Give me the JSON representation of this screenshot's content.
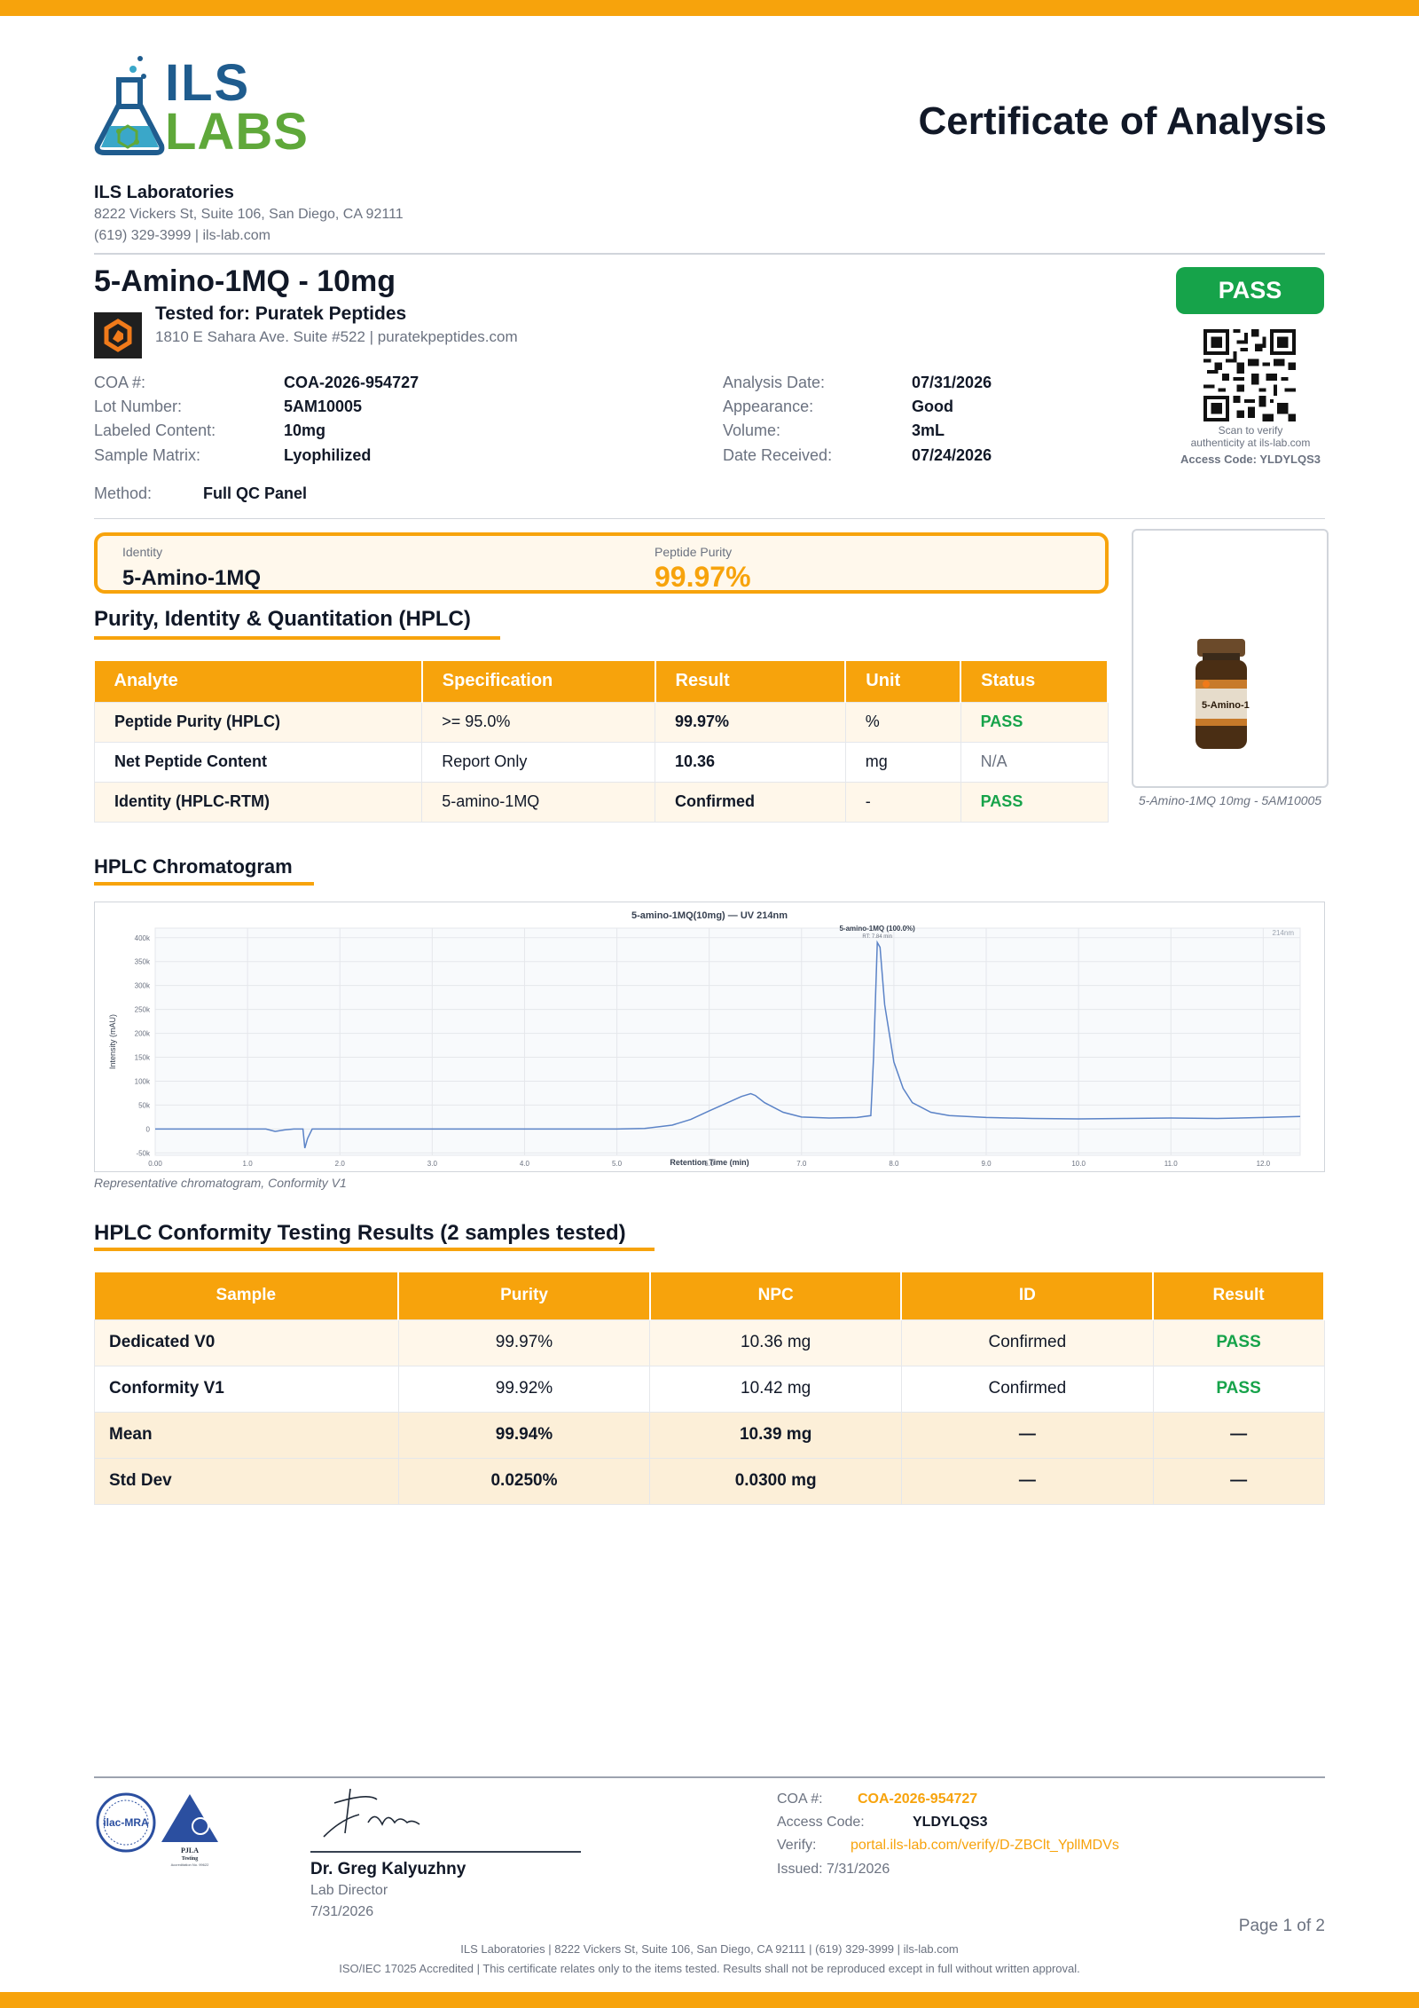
{
  "header": {
    "logo_top": "ILS",
    "logo_bottom": "LABS",
    "title": "Certificate of Analysis",
    "lab_name": "ILS Laboratories",
    "lab_address": "8222 Vickers St, Suite 106, San Diego, CA 92111",
    "lab_contact": "(619) 329-3999  |  ils-lab.com"
  },
  "product": {
    "title": "5-Amino-1MQ - 10mg",
    "tested_for": "Tested for: Puratek Peptides",
    "client_address": "1810 E Sahara Ave. Suite #522  |  puratekpeptides.com",
    "status": "PASS"
  },
  "qr": {
    "caption_1": "Scan to verify",
    "caption_2": "authenticity at ils-lab.com",
    "access_code": "Access Code: YLDYLQS3"
  },
  "meta_left": [
    {
      "label": "COA #:",
      "value": "COA-2026-954727"
    },
    {
      "label": "Lot Number:",
      "value": "5AM10005"
    },
    {
      "label": "Labeled Content:",
      "value": "10mg"
    },
    {
      "label": "Sample Matrix:",
      "value": "Lyophilized"
    }
  ],
  "meta_right": [
    {
      "label": "Analysis Date:",
      "value": "07/31/2026"
    },
    {
      "label": "Appearance:",
      "value": "Good"
    },
    {
      "label": "Volume:",
      "value": "3mL"
    },
    {
      "label": "Date Received:",
      "value": "07/24/2026"
    }
  ],
  "method": {
    "label": "Method:",
    "value": "Full QC Panel"
  },
  "summary": {
    "identity_label": "Identity",
    "identity_value": "5-Amino-1MQ",
    "purity_label": "Peptide Purity",
    "purity_value": "99.97%"
  },
  "vial": {
    "label_text": "5-Amino-1",
    "caption": "5-Amino-1MQ 10mg - 5AM10005"
  },
  "hplc_table": {
    "title": "Purity, Identity & Quantitation (HPLC)",
    "headers": [
      "Analyte",
      "Specification",
      "Result",
      "Unit",
      "Status"
    ],
    "rows": [
      [
        "Peptide Purity (HPLC)",
        ">= 95.0%",
        "99.97%",
        "%",
        "PASS"
      ],
      [
        "Net Peptide Content",
        "Report Only",
        "10.36",
        "mg",
        "N/A"
      ],
      [
        "Identity (HPLC-RTM)",
        "5-amino-1MQ",
        "Confirmed",
        "-",
        "PASS"
      ]
    ]
  },
  "chromatogram": {
    "section_title": "HPLC Chromatogram",
    "caption": "Representative chromatogram, Conformity V1"
  },
  "chart_data": {
    "type": "line",
    "title": "5-amino-1MQ(10mg) — UV 214nm",
    "xlabel": "Retention Time (min)",
    "ylabel": "Intensity (mAU)",
    "xlim": [
      0,
      12.4
    ],
    "ylim": [
      -55000,
      420000
    ],
    "x_ticks": [
      "0.00",
      "1.0",
      "2.0",
      "3.0",
      "4.0",
      "5.0",
      "6.0",
      "7.0",
      "8.0",
      "9.0",
      "10.0",
      "11.0",
      "12.0"
    ],
    "y_ticks": [
      "-50k",
      "0",
      "50k",
      "100k",
      "150k",
      "200k",
      "250k",
      "300k",
      "350k",
      "400k"
    ],
    "peak_label": "5-amino-1MQ (100.0%)",
    "peak_sublabel": "RT: 7.84 min",
    "wavelength_label": "214nm",
    "grid": true,
    "series": [
      {
        "x": [
          0,
          1.2,
          1.3,
          1.4,
          1.5,
          1.6,
          1.62,
          1.65,
          1.7,
          1.8,
          2.0,
          3.0,
          4.0,
          5.0,
          5.3,
          5.6,
          5.8,
          6.0,
          6.2,
          6.35,
          6.45,
          6.5,
          6.6,
          6.8,
          7.0,
          7.3,
          7.6,
          7.75,
          7.78,
          7.82,
          7.85,
          7.9,
          8.0,
          8.1,
          8.2,
          8.4,
          8.6,
          9.0,
          9.5,
          10.0,
          10.5,
          11.0,
          11.5,
          12.0,
          12.4
        ],
        "y": [
          0,
          0,
          -5000,
          -2000,
          0,
          0,
          -40000,
          -20000,
          0,
          0,
          0,
          0,
          0,
          0,
          1000,
          8000,
          20000,
          38000,
          55000,
          68000,
          74000,
          70000,
          55000,
          35000,
          25000,
          23000,
          24000,
          28000,
          150000,
          390000,
          380000,
          260000,
          140000,
          85000,
          55000,
          35000,
          28000,
          24000,
          22000,
          21000,
          22000,
          23000,
          22000,
          24000,
          26000
        ]
      }
    ]
  },
  "conformity": {
    "title": "HPLC Conformity Testing Results (2 samples tested)",
    "headers": [
      "Sample",
      "Purity",
      "NPC",
      "ID",
      "Result"
    ],
    "rows": [
      [
        "Dedicated V0",
        "99.97%",
        "10.36 mg",
        "Confirmed",
        "PASS"
      ],
      [
        "Conformity V1",
        "99.92%",
        "10.42 mg",
        "Confirmed",
        "PASS"
      ]
    ],
    "stats": [
      [
        "Mean",
        "99.94%",
        "10.39 mg",
        "—",
        "—"
      ],
      [
        "Std Dev",
        "0.0250%",
        "0.0300 mg",
        "—",
        "—"
      ]
    ]
  },
  "accreditation": {
    "ilac": "ilac-MRA",
    "pjla": "PJLA",
    "pjla_sub": "Testing",
    "pjla_no": "Accreditation No. 99622"
  },
  "signature": {
    "name": "Dr. Greg Kalyuzhny",
    "role": "Lab Director",
    "date": "7/31/2026"
  },
  "footer_info": {
    "coa_label": "COA #:",
    "coa_value": "COA-2026-954727",
    "access_label": "Access Code:",
    "access_value": "YLDYLQS3",
    "verify_label": "Verify:",
    "verify_value": "portal.ils-lab.com/verify/D-ZBClt_YpllMDVs",
    "issued": "Issued: 7/31/2026"
  },
  "page": "Page 1 of 2",
  "legal": {
    "line1": "ILS Laboratories  |  8222 Vickers St, Suite 106, San Diego, CA 92111  |  (619) 329-3999  |  ils-lab.com",
    "line2": "ISO/IEC 17025 Accredited  |  This certificate relates only to the items tested. Results shall not be reproduced except in full without written approval."
  },
  "colors": {
    "accent": "#F7A30C",
    "pass": "#16A34A",
    "logo_blue": "#1F5C8E",
    "logo_green": "#5FA83A",
    "trace": "#5B83C7"
  }
}
